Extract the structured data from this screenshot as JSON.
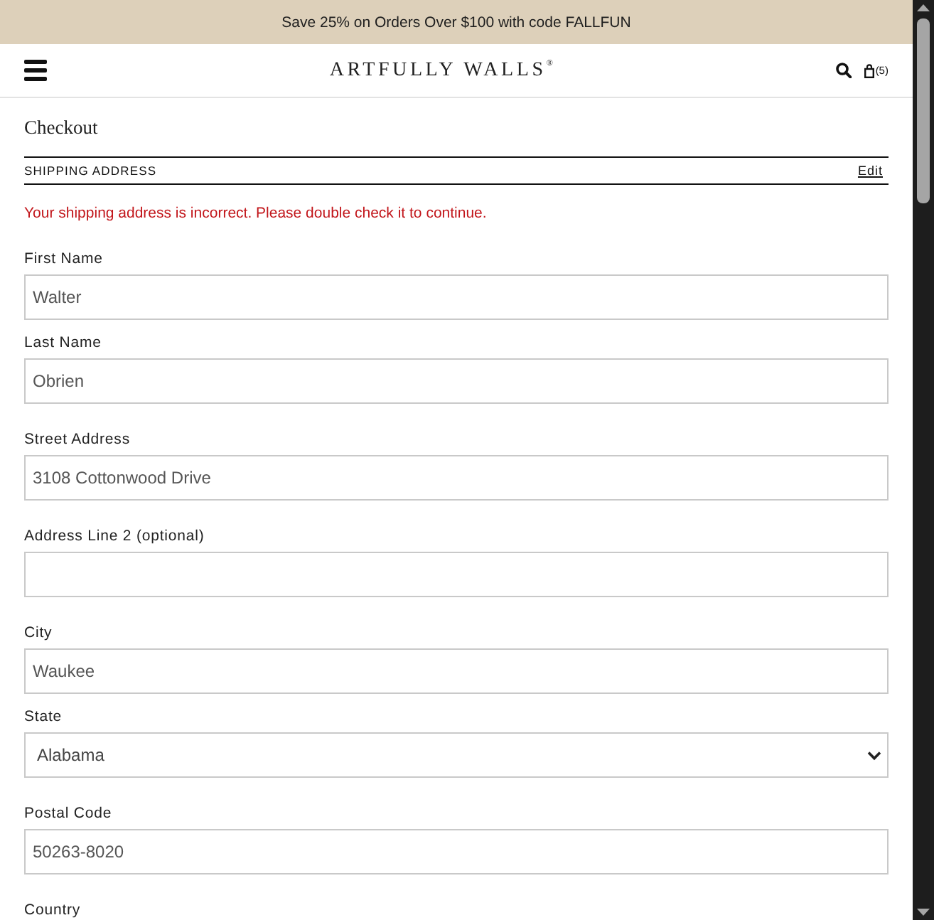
{
  "banner": {
    "text": "Save 25% on Orders Over $100 with code FALLFUN"
  },
  "header": {
    "logo": "ARTFULLY WALLS",
    "logo_mark": "®",
    "cart_count": "(5)"
  },
  "checkout": {
    "title": "Checkout",
    "section": {
      "title": "SHIPPING ADDRESS",
      "action": "Edit"
    },
    "error": "Your shipping address is incorrect. Please double check it to continue."
  },
  "field_groups": [
    {
      "fields": [
        {
          "kind": "text",
          "label": "First Name",
          "value": "Walter"
        },
        {
          "kind": "text",
          "label": "Last Name",
          "value": "Obrien"
        }
      ]
    },
    {
      "fields": [
        {
          "kind": "text",
          "label": "Street Address",
          "value": "3108 Cottonwood Drive"
        }
      ]
    },
    {
      "fields": [
        {
          "kind": "text",
          "label": "Address Line 2 (optional)"
        }
      ]
    },
    {
      "fields": [
        {
          "kind": "text",
          "label": "City",
          "value": "Waukee"
        },
        {
          "kind": "select",
          "label": "State",
          "value": "Alabama"
        }
      ]
    },
    {
      "fields": [
        {
          "kind": "text",
          "label": "Postal Code",
          "value": "50263-8020"
        }
      ]
    },
    {
      "fields": [
        {
          "kind": "label",
          "label": "Country"
        }
      ]
    }
  ]
}
